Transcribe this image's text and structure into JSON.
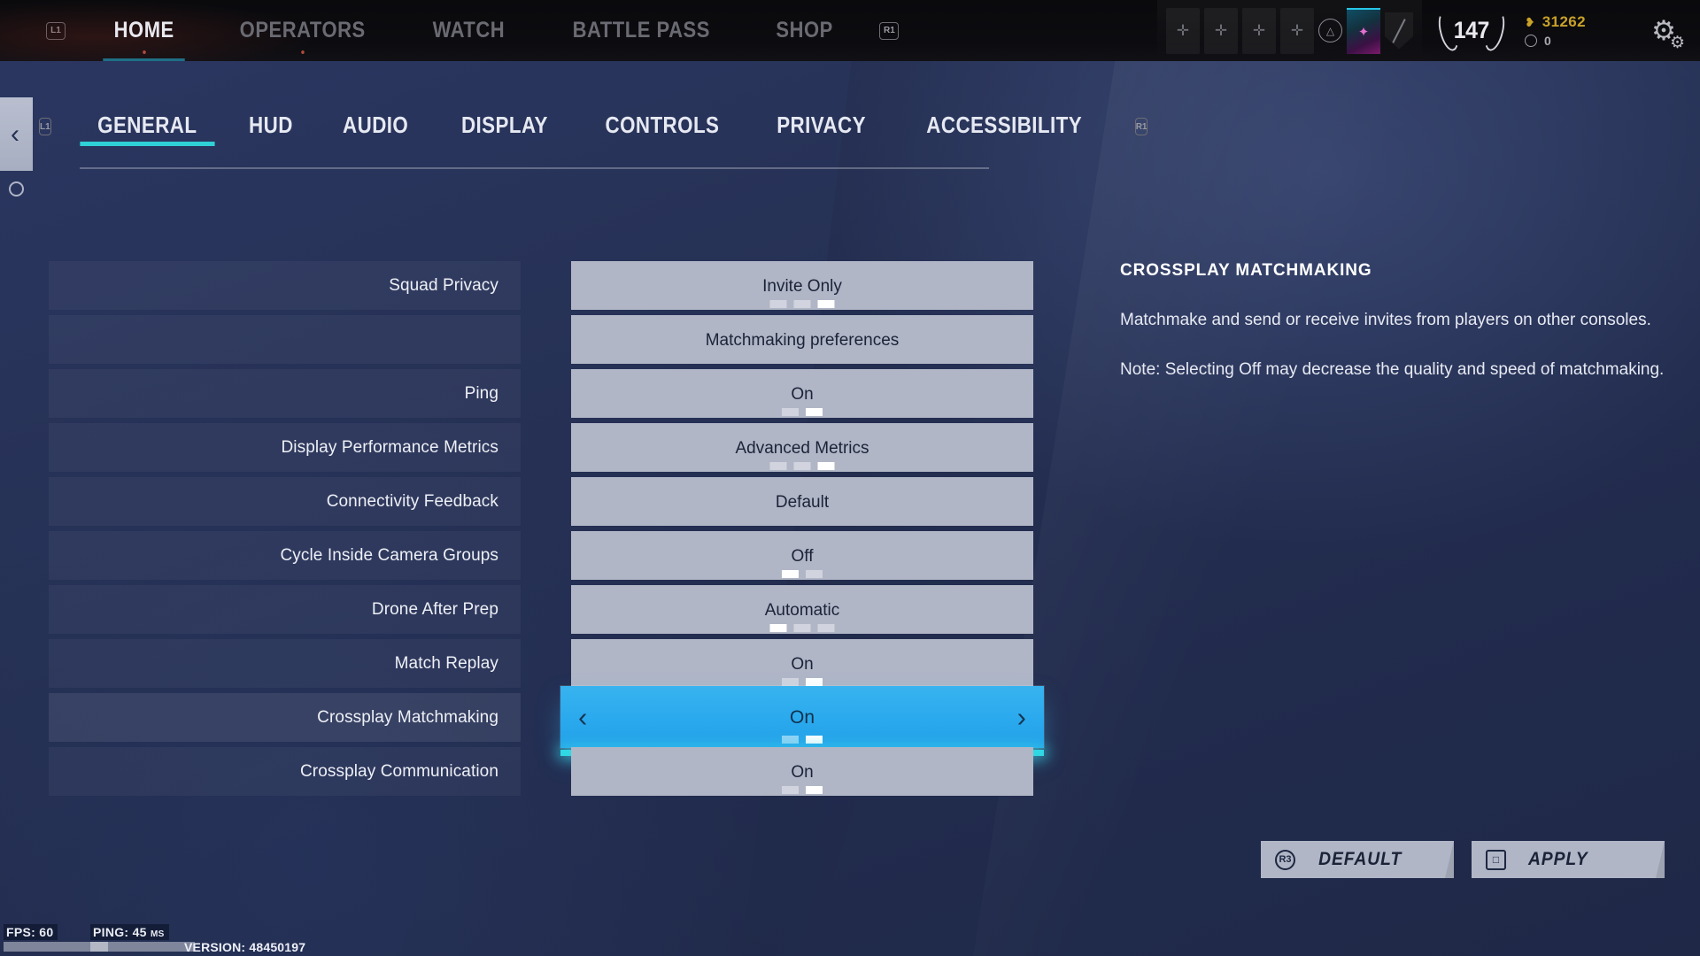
{
  "header": {
    "left_bumper": "L1",
    "right_bumper": "R1",
    "nav": [
      {
        "label": "HOME",
        "active": true,
        "dot": true
      },
      {
        "label": "OPERATORS",
        "active": false,
        "dot": true
      },
      {
        "label": "WATCH",
        "active": false,
        "dot": false
      },
      {
        "label": "BATTLE PASS",
        "active": false,
        "dot": false
      },
      {
        "label": "SHOP",
        "active": false,
        "dot": false
      }
    ],
    "loadout_slots": [
      "plus-icon",
      "plus-icon",
      "plus-icon",
      "plus-icon"
    ],
    "charm_icon": "triangle-icon",
    "card_icon": "player-card-icon",
    "emblem_icon": "shield-icon",
    "level": "147",
    "currency_gold": "31262",
    "currency_credits": "0",
    "settings_icon": "gear-icon"
  },
  "back_button": "back-chevron-icon",
  "tabs": [
    {
      "label": "GENERAL",
      "active": true
    },
    {
      "label": "HUD",
      "active": false
    },
    {
      "label": "AUDIO",
      "active": false
    },
    {
      "label": "DISPLAY",
      "active": false
    },
    {
      "label": "CONTROLS",
      "active": false
    },
    {
      "label": "PRIVACY",
      "active": false
    },
    {
      "label": "ACCESSIBILITY",
      "active": false
    }
  ],
  "tab_bumper_left": "L1",
  "tab_bumper_right": "R1",
  "settings_rows": [
    {
      "label": "Squad Privacy",
      "value": "Invite Only",
      "dots": 3,
      "active_dot": 2,
      "selected": false
    },
    {
      "label": "",
      "value": "Matchmaking preferences",
      "dots": 0,
      "active_dot": -1,
      "selected": false
    },
    {
      "label": "Ping",
      "value": "On",
      "dots": 2,
      "active_dot": 1,
      "selected": false
    },
    {
      "label": "Display Performance Metrics",
      "value": "Advanced Metrics",
      "dots": 3,
      "active_dot": 2,
      "selected": false
    },
    {
      "label": "Connectivity Feedback",
      "value": "Default",
      "dots": 0,
      "active_dot": -1,
      "selected": false
    },
    {
      "label": "Cycle Inside Camera Groups",
      "value": "Off",
      "dots": 2,
      "active_dot": 0,
      "selected": false
    },
    {
      "label": "Drone After Prep",
      "value": "Automatic",
      "dots": 3,
      "active_dot": 0,
      "selected": false
    },
    {
      "label": "Match Replay",
      "value": "On",
      "dots": 2,
      "active_dot": 1,
      "selected": false
    },
    {
      "label": "Crossplay Matchmaking",
      "value": "On",
      "dots": 2,
      "active_dot": 1,
      "selected": true
    },
    {
      "label": "Crossplay Communication",
      "value": "On",
      "dots": 2,
      "active_dot": 1,
      "selected": false
    }
  ],
  "selected_arrows": {
    "left": "chevron-left-icon",
    "right": "chevron-right-icon"
  },
  "description": {
    "title": "CROSSPLAY MATCHMAKING",
    "paragraph1": "Matchmake and send or receive invites from players on other consoles.",
    "paragraph2": "Note: Selecting Off may decrease the quality and speed of matchmaking."
  },
  "buttons": [
    {
      "badge": "R3",
      "label": "DEFAULT",
      "badge_shape": "circle"
    },
    {
      "badge": "□",
      "label": "APPLY",
      "badge_shape": "square"
    }
  ],
  "status_bar": {
    "fps_label": "FPS: 60",
    "ping_label": "PING: 45",
    "ping_unit": "MS",
    "version": "VERSION: 48450197"
  },
  "colors": {
    "accent_cyan": "#2fd0d6",
    "selected_blue": "#2aa9ee",
    "row_value_bg": "#b0b6c6",
    "gold": "#c9a227"
  }
}
